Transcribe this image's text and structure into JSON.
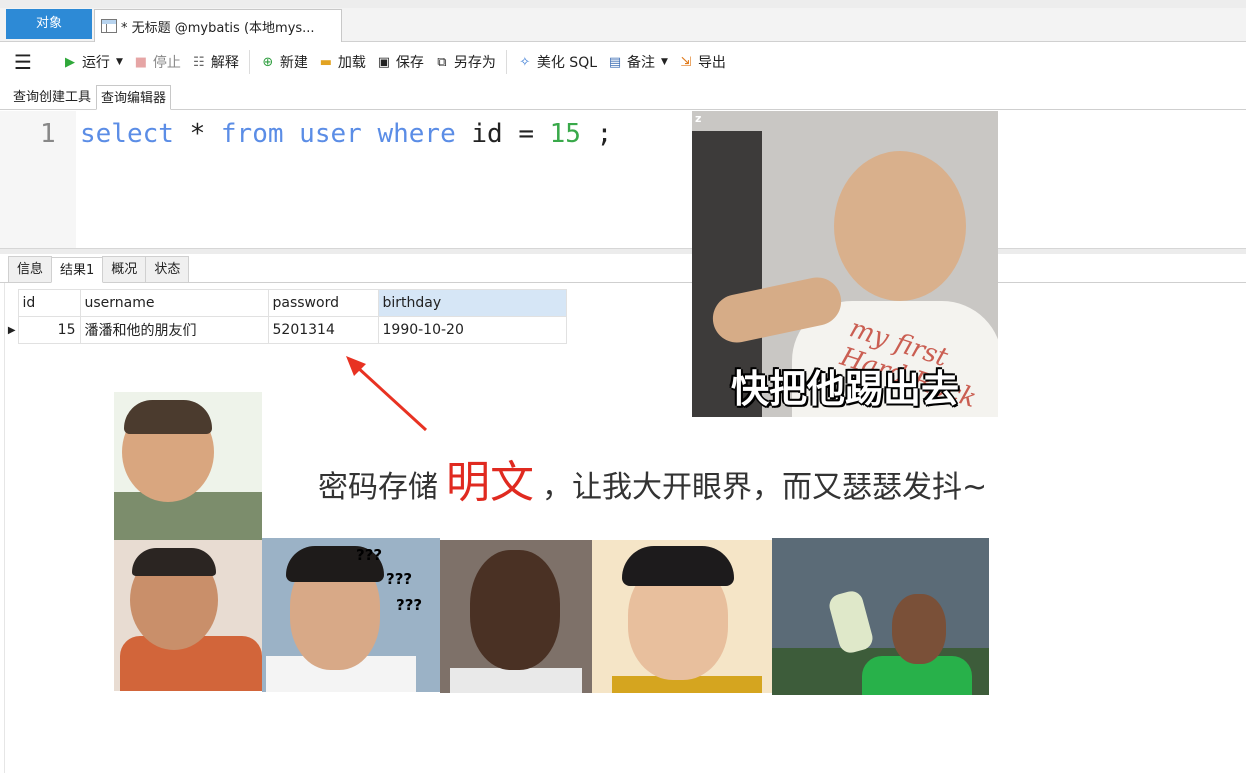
{
  "top_tabs": {
    "objects_label": "对象",
    "query_tab_label": "* 无标题 @mybatis (本地mys..."
  },
  "toolbar": {
    "run_label": "运行",
    "stop_label": "停止",
    "explain_label": "解释",
    "new_label": "新建",
    "load_label": "加载",
    "save_label": "保存",
    "save_as_label": "另存为",
    "beautify_label": "美化 SQL",
    "comment_label": "备注",
    "export_label": "导出"
  },
  "sub_tabs": [
    "查询创建工具",
    "查询编辑器"
  ],
  "editor": {
    "line_number": "1",
    "tokens": {
      "select": "select",
      "star": " * ",
      "from": "from",
      "table": "user",
      "where": "where",
      "rest": " id = ",
      "value": "15",
      "end": " ;"
    }
  },
  "result_tabs": [
    "信息",
    "结果1",
    "概况",
    "状态"
  ],
  "grid": {
    "columns": [
      "id",
      "username",
      "password",
      "birthday"
    ],
    "rows": [
      {
        "id": "15",
        "username": "潘潘和他的朋友们",
        "password": "5201314",
        "birthday": "1990-10-20"
      }
    ]
  },
  "annotation": {
    "before": "密码存储",
    "highlight": "明文",
    "after": "，让我大开眼界，而又瑟瑟发抖~"
  },
  "memes": {
    "big_caption": "快把他踢出去",
    "corner_mark": "z",
    "shirt_text": "my first Hard Rock",
    "question_marks": [
      "???",
      "???",
      "???"
    ]
  },
  "colors": {
    "accent_tab": "#2d8ad6",
    "keyword": "#5b8de6",
    "number": "#39a94a",
    "highlight": "#e02a20",
    "arrow": "#e83222"
  }
}
